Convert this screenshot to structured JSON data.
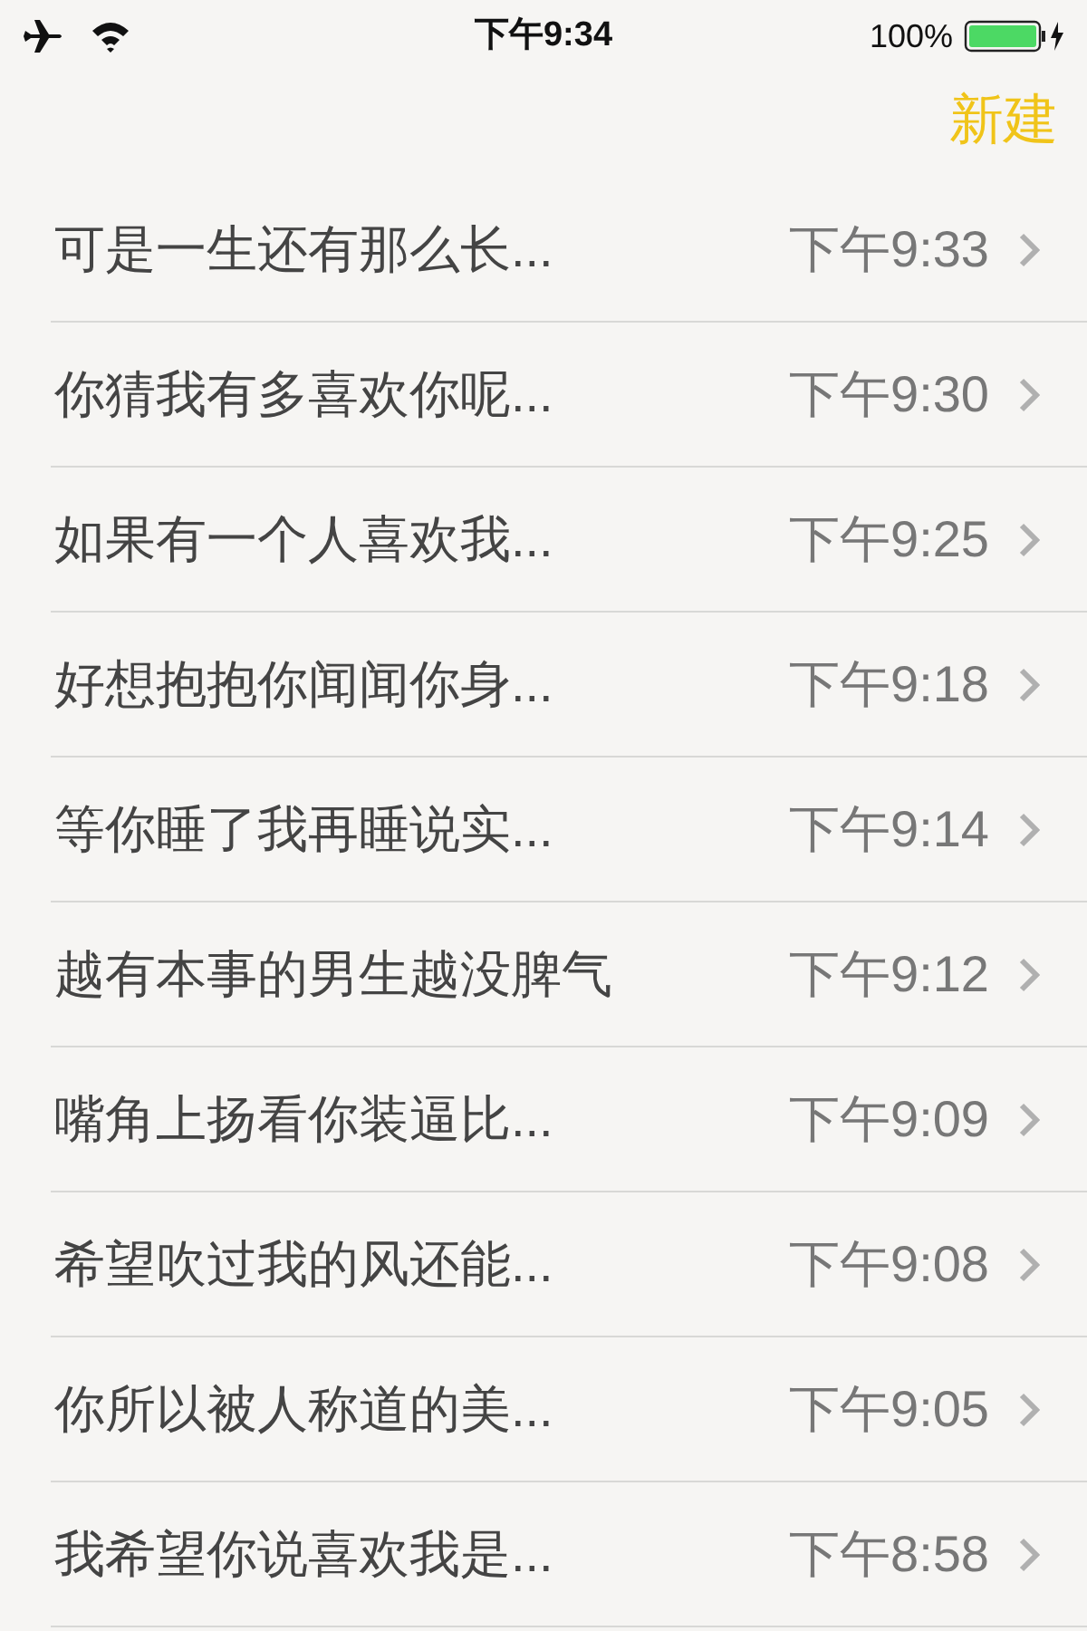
{
  "status_bar": {
    "time": "下午9:34",
    "battery": "100%"
  },
  "nav": {
    "new_button": "新建"
  },
  "notes": [
    {
      "title": "可是一生还有那么长...",
      "time": "下午9:33"
    },
    {
      "title": "你猜我有多喜欢你呢...",
      "time": "下午9:30"
    },
    {
      "title": "如果有一个人喜欢我...",
      "time": "下午9:25"
    },
    {
      "title": "好想抱抱你闻闻你身...",
      "time": "下午9:18"
    },
    {
      "title": "等你睡了我再睡说实...",
      "time": "下午9:14"
    },
    {
      "title": "越有本事的男生越没脾气",
      "time": "下午9:12"
    },
    {
      "title": "嘴角上扬看你装逼比...",
      "time": "下午9:09"
    },
    {
      "title": "希望吹过我的风还能...",
      "time": "下午9:08"
    },
    {
      "title": "你所以被人称道的美...",
      "time": "下午9:05"
    },
    {
      "title": "我希望你说喜欢我是...",
      "time": "下午8:58"
    }
  ]
}
